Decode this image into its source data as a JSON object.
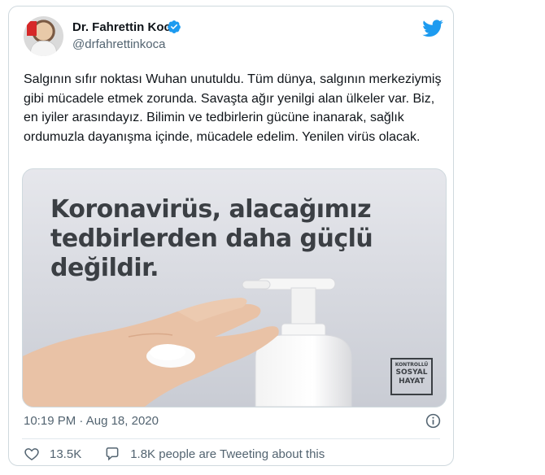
{
  "author": {
    "name": "Dr. Fahrettin Koca",
    "handle": "@drfahrettinkoca",
    "verified": true
  },
  "tweet": {
    "text": "Salgının sıfır noktası Wuhan unutuldu. Tüm dünya, salgının merkeziymiş gibi mücadele etmek zorunda. Savaşta ağır yenilgi alan ülkeler var. Biz, en iyiler arasındayız. Bilimin ve tedbirlerin gücüne inanarak, sağlık ordumuzla dayanışma içinde, mücadele edelim. Yenilen virüs olacak.",
    "image": {
      "headline": "Koronavirüs, alacağımız tedbirlerden daha güçlü değildir.",
      "badge": [
        "KONTROLLÜ",
        "SOSYAL",
        "HAYAT"
      ]
    },
    "time": "10:19 PM",
    "separator": "·",
    "date": "Aug 18, 2020"
  },
  "stats": {
    "likes": "13.5K",
    "tweeting": "1.8K people are Tweeting about this"
  },
  "icons": {
    "brand": "twitter-bird-icon",
    "verified": "verified-badge-icon",
    "info": "info-icon",
    "like": "heart-icon",
    "reply": "speech-bubble-icon"
  },
  "colors": {
    "twitter_blue": "#1d9bf0",
    "secondary_text": "#536471",
    "primary_text": "#0f1419",
    "border": "#cfd9de"
  }
}
